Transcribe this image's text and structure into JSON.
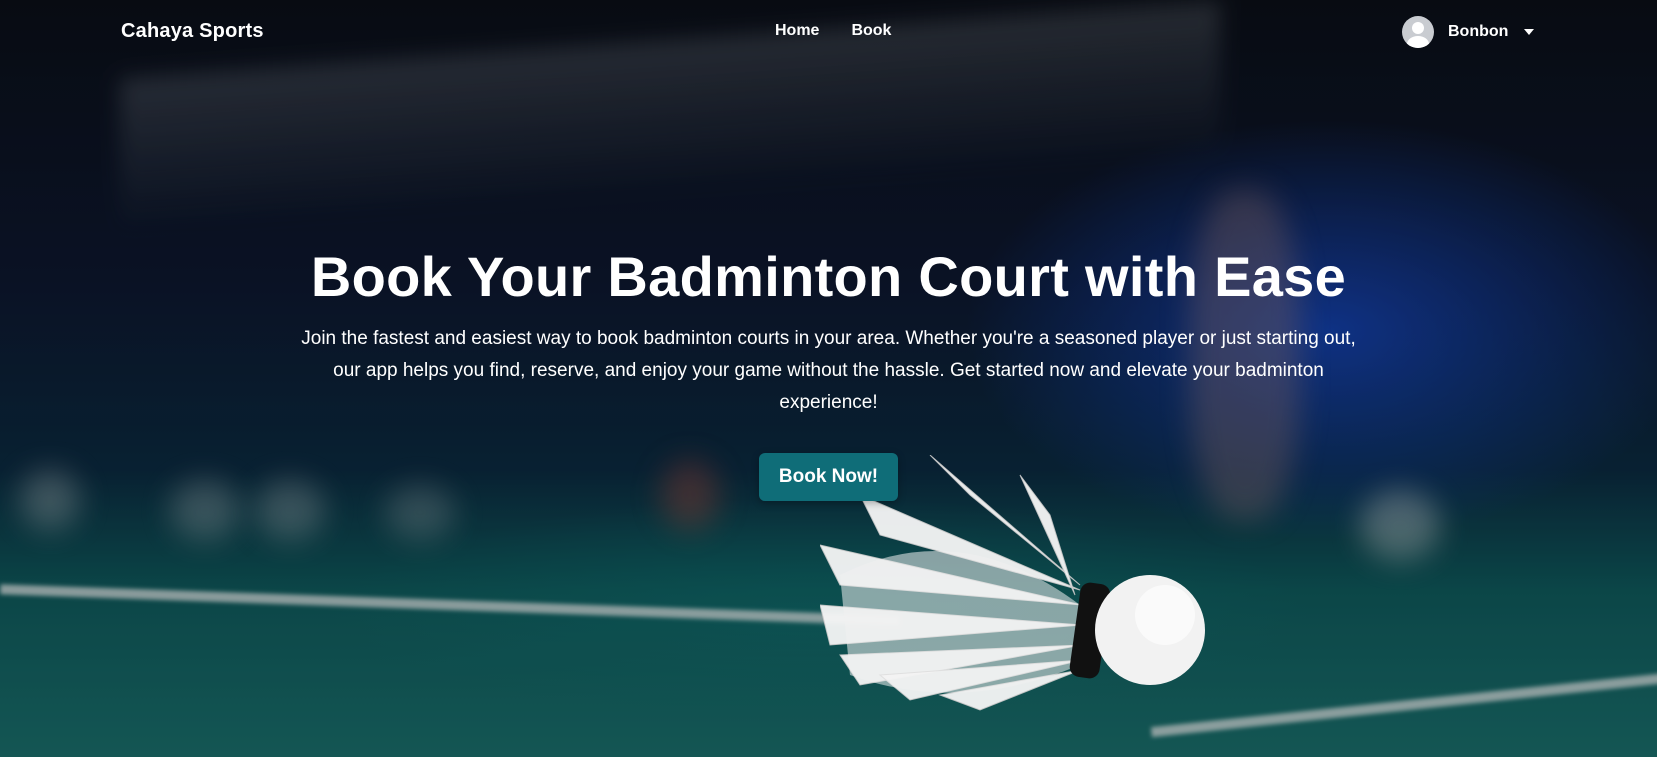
{
  "navbar": {
    "brand": "Cahaya Sports",
    "links": [
      {
        "label": "Home"
      },
      {
        "label": "Book"
      }
    ],
    "user": {
      "name": "Bonbon"
    }
  },
  "hero": {
    "headline": "Book Your Badminton Court with Ease",
    "subtext": "Join the fastest and easiest way to book badminton courts in your area. Whether you're a seasoned player or just starting out, our app helps you find, reserve, and enjoy your game without the hassle. Get started now and elevate your badminton experience!",
    "cta_label": "Book Now!"
  },
  "colors": {
    "cta_background": "#0f6d78",
    "court": "#1a6f6c",
    "backdrop_blue": "#1446be"
  },
  "icons": {
    "avatar": "user-avatar-icon",
    "dropdown": "chevron-down-icon"
  }
}
